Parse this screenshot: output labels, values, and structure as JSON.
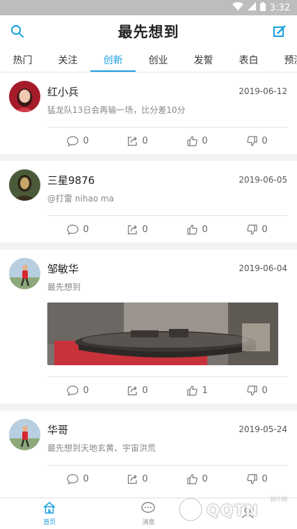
{
  "status": {
    "time": "3:32"
  },
  "header": {
    "title": "最先想到"
  },
  "tabs": [
    {
      "label": "热门"
    },
    {
      "label": "关注"
    },
    {
      "label": "创新"
    },
    {
      "label": "创业"
    },
    {
      "label": "发誓"
    },
    {
      "label": "表白"
    },
    {
      "label": "预测"
    }
  ],
  "posts": [
    {
      "name": "红小兵",
      "date": "2019-06-12",
      "content": "猛龙队13日会再输一场，比分差10分",
      "comments": "0",
      "shares": "0",
      "likes": "0",
      "dislikes": "0"
    },
    {
      "name": "三星9876",
      "date": "2019-06-05",
      "content": "@打雷 nihao ma",
      "comments": "0",
      "shares": "0",
      "likes": "0",
      "dislikes": "0"
    },
    {
      "name": "邹敏华",
      "date": "2019-06-04",
      "content": "最先想到",
      "comments": "0",
      "shares": "0",
      "likes": "1",
      "dislikes": "0"
    },
    {
      "name": "华哥",
      "date": "2019-05-24",
      "content": "最先想到天地玄黄、宇宙洪荒",
      "comments": "0",
      "shares": "0",
      "likes": "0",
      "dislikes": "0"
    }
  ],
  "bottom_nav": [
    {
      "label": "首页"
    },
    {
      "label": "消息"
    }
  ],
  "watermark": {
    "text": "QQTN",
    "small": "腾牛网"
  },
  "colors": {
    "accent": "#1a9ee0",
    "status_bar": "#bdbdbd"
  }
}
